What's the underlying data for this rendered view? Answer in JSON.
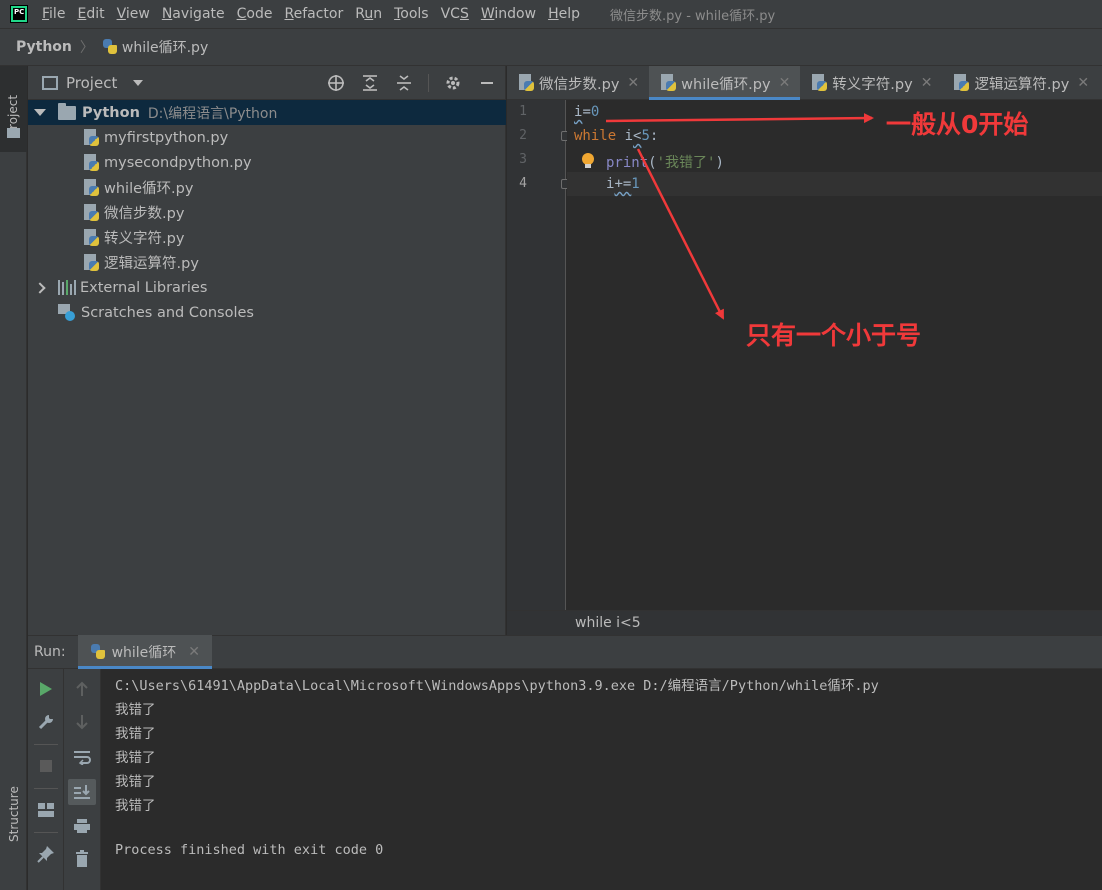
{
  "menubar": {
    "items": [
      "File",
      "Edit",
      "View",
      "Navigate",
      "Code",
      "Refactor",
      "Run",
      "Tools",
      "VCS",
      "Window",
      "Help"
    ],
    "mnemonics": [
      "F",
      "E",
      "V",
      "N",
      "C",
      "R",
      "u",
      "T",
      "S",
      "W",
      "H"
    ],
    "window_title": "微信步数.py - while循环.py",
    "logo_text": "PC"
  },
  "navbar": {
    "project": "Python",
    "file": "while循环.py"
  },
  "left_strip": {
    "project_label": "Project",
    "structure_label": "Structure"
  },
  "project_panel": {
    "title": "Project",
    "root": {
      "name": "Python",
      "path": "D:\\编程语言\\Python"
    },
    "files": [
      "myfirstpython.py",
      "mysecondpython.py",
      "while循环.py",
      "微信步数.py",
      "转义字符.py",
      "逻辑运算符.py"
    ],
    "external_libraries": "External Libraries",
    "scratches": "Scratches and Consoles"
  },
  "editor": {
    "tabs": [
      {
        "label": "微信步数.py",
        "active": false
      },
      {
        "label": "while循环.py",
        "active": true
      },
      {
        "label": "转义字符.py",
        "active": false
      },
      {
        "label": "逻辑运算符.py",
        "active": false
      }
    ],
    "line_numbers": [
      "1",
      "2",
      "3",
      "4"
    ],
    "code": {
      "l1_var": "i",
      "l1_op": "=",
      "l1_num": "0",
      "l2_kw": "while",
      "l2_var": " i",
      "l2_op": "<",
      "l2_num": "5",
      "l2_colon": ":",
      "l3_fn": "print",
      "l3_open": "(",
      "l3_str": "'我错了'",
      "l3_close": ")",
      "l4_var": "i",
      "l4_op": "+=",
      "l4_num": "1"
    },
    "breadcrumb": "while i<5"
  },
  "annotations": {
    "note1": "一般从0开始",
    "note2": "只有一个小于号",
    "color": "#f0393a"
  },
  "run": {
    "label": "Run:",
    "tab": "while循环",
    "command": "C:\\Users\\61491\\AppData\\Local\\Microsoft\\WindowsApps\\python3.9.exe D:/编程语言/Python/while循环.py",
    "output": [
      "我错了",
      "我错了",
      "我错了",
      "我错了",
      "我错了"
    ],
    "exit": "Process finished with exit code 0"
  },
  "colors": {
    "background": "#2b2b2b",
    "panel": "#3c3f41",
    "selection": "#0d293e",
    "accent": "#4a88c7",
    "keyword": "#cc7832",
    "number": "#6897bb",
    "string": "#6a8759"
  }
}
